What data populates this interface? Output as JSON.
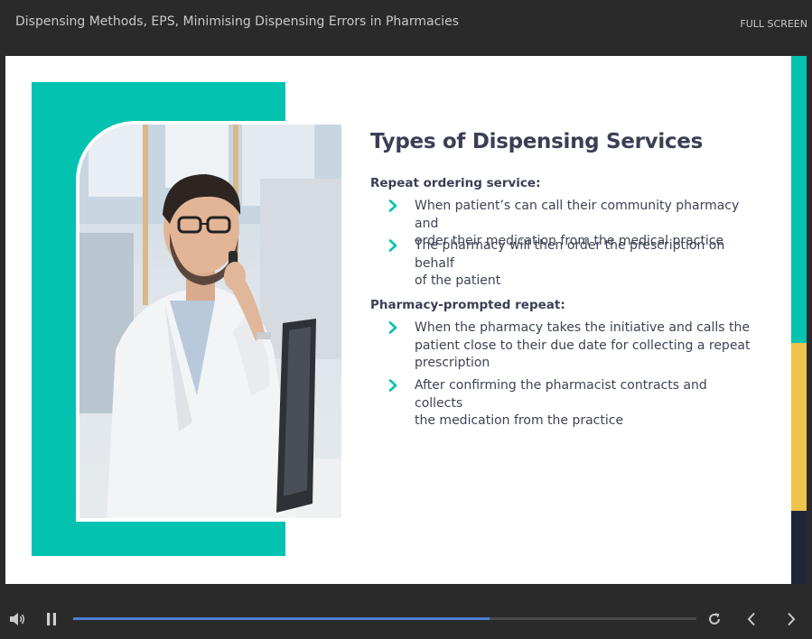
{
  "header": {
    "course_title": "Dispensing Methods, EPS, Minimising Dispensing Errors in Pharmacies",
    "fullscreen_label": "FULL SCREEN"
  },
  "slide": {
    "heading": "Types of Dispensing Services",
    "sections": [
      {
        "title": "Repeat ordering service:",
        "bullets": [
          [
            "When patient’s can call their community pharmacy and",
            "order their medication from the medical practice"
          ],
          [
            "The pharmacy will then order the prescription on behalf",
            "of the patient"
          ]
        ]
      },
      {
        "title": "Pharmacy-prompted repeat:",
        "bullets": [
          [
            "When the pharmacy takes the initiative and calls the",
            "patient close to their due date for collecting a repeat",
            "prescription"
          ],
          [
            "After confirming the pharmacist contracts and collects",
            "the medication from the practice"
          ]
        ]
      }
    ]
  },
  "playback": {
    "progress_fraction": 0.668,
    "state": "playing"
  },
  "colors": {
    "accent_teal": "#03c2b0",
    "accent_yellow": "#f0c34c",
    "accent_navy": "#1d2738",
    "progress_blue": "#4c7fd1",
    "heading_text": "#3b3f55"
  },
  "icons": [
    "volume-icon",
    "pause-icon",
    "replay-icon",
    "previous-icon",
    "next-icon",
    "chevron-right-icon"
  ]
}
